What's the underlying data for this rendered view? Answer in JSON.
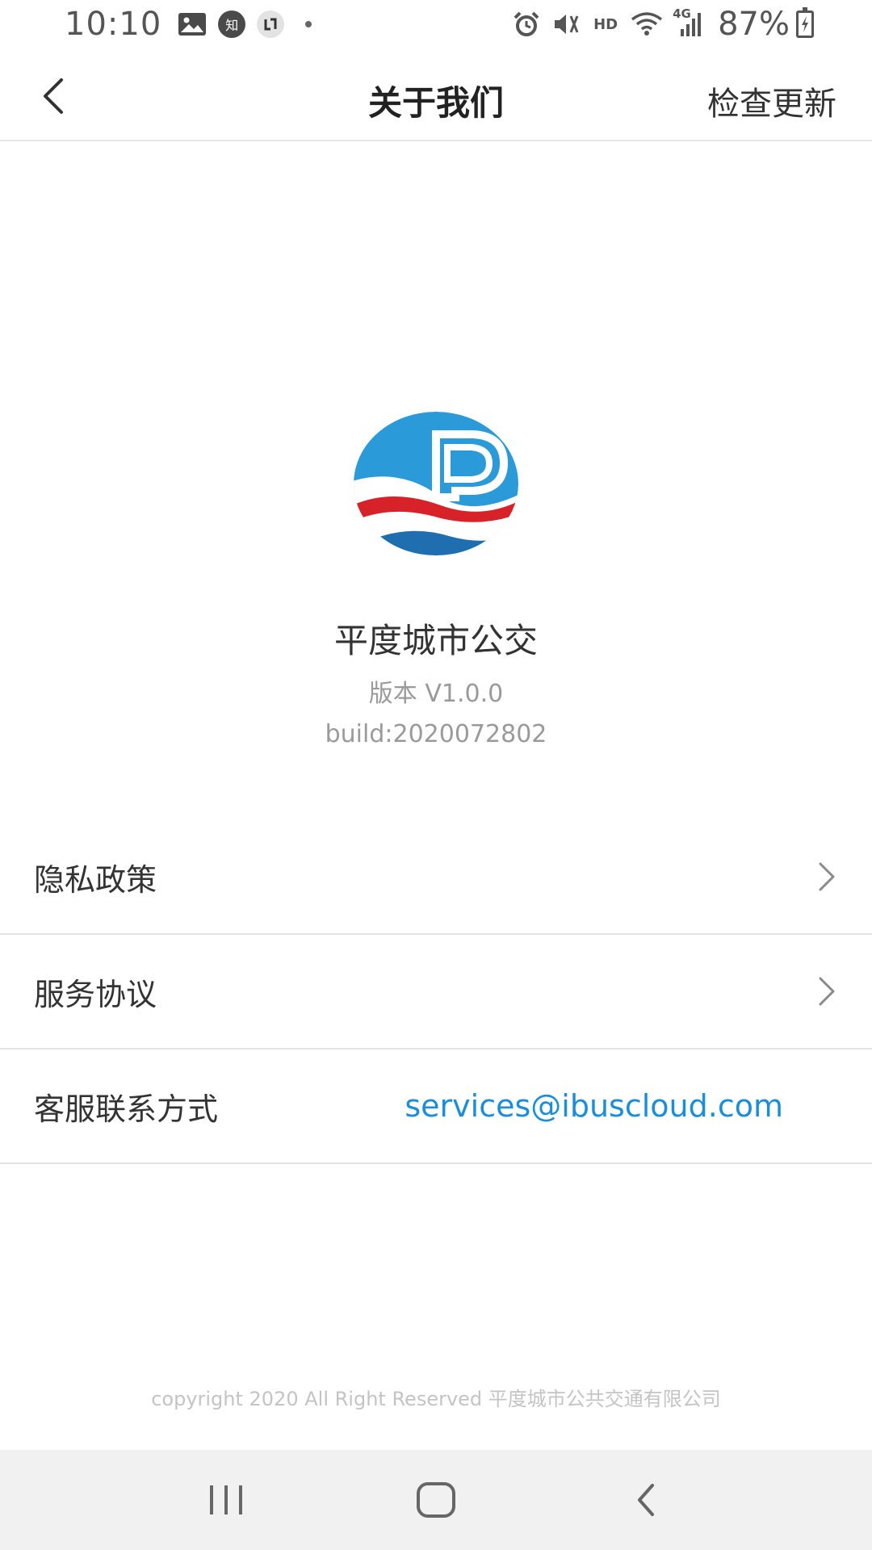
{
  "status_bar": {
    "time": "10:10",
    "notif_zhihu": "知",
    "network_type": "HD",
    "signal_label": "4G",
    "battery_percent": "87%"
  },
  "header": {
    "title": "关于我们",
    "check_update": "检查更新"
  },
  "app": {
    "name": "平度城市公交",
    "version": "版本 V1.0.0",
    "build": "build:2020072802"
  },
  "menu": [
    {
      "label": "隐私政策"
    },
    {
      "label": "服务协议"
    },
    {
      "label": "客服联系方式",
      "value": "services@ibuscloud.com"
    }
  ],
  "footer": {
    "copyright": "copyright  2020 All Right Reserved 平度城市公共交通有限公司"
  },
  "colors": {
    "link": "#1a8ddb",
    "logo_blue": "#2a9ad8",
    "logo_red": "#d8222a",
    "logo_dark_blue": "#1f6fb0"
  },
  "icons": {
    "back": "chevron-left-icon",
    "row_arrow": "chevron-right-icon",
    "sys_recent": "recent-apps-icon",
    "sys_home": "home-icon",
    "sys_back": "back-icon"
  }
}
